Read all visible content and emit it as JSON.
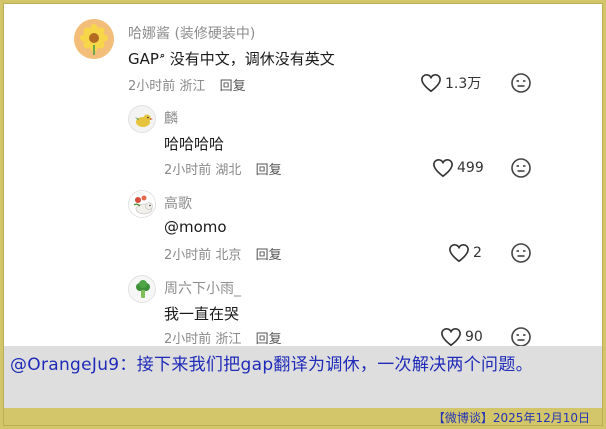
{
  "comments": [
    {
      "username": "哈娜酱 (装修硬装中)",
      "text_prefix": "GAP",
      "gap_icon": "search-superscript-icon",
      "text": " 没有中文，调休没有英文",
      "time": "2小时前",
      "location": "浙江",
      "reply_label": "回复",
      "likes": "1.3万"
    },
    {
      "username": "麟",
      "text": "哈哈哈哈",
      "time": "2小时前",
      "location": "湖北",
      "reply_label": "回复",
      "likes": "499"
    },
    {
      "username": "高歌",
      "text": "@momo",
      "time": "2小时前",
      "location": "北京",
      "reply_label": "回复",
      "likes": "2"
    },
    {
      "username": "周六下小雨_",
      "text": "我一直在哭",
      "time": "2小时前",
      "location": "浙江",
      "reply_label": "回复",
      "likes": "90"
    }
  ],
  "caption": {
    "text": "@OrangeJu9：接下来我们把gap翻译为调休，一次解决两个问题。"
  },
  "footer": {
    "text": "【微博谈】2025年12月10日"
  },
  "colors": {
    "border": "#d2c56a",
    "caption_text": "#1f2bb8",
    "footer_text": "#2636b5",
    "caption_bg": "#dedede"
  }
}
